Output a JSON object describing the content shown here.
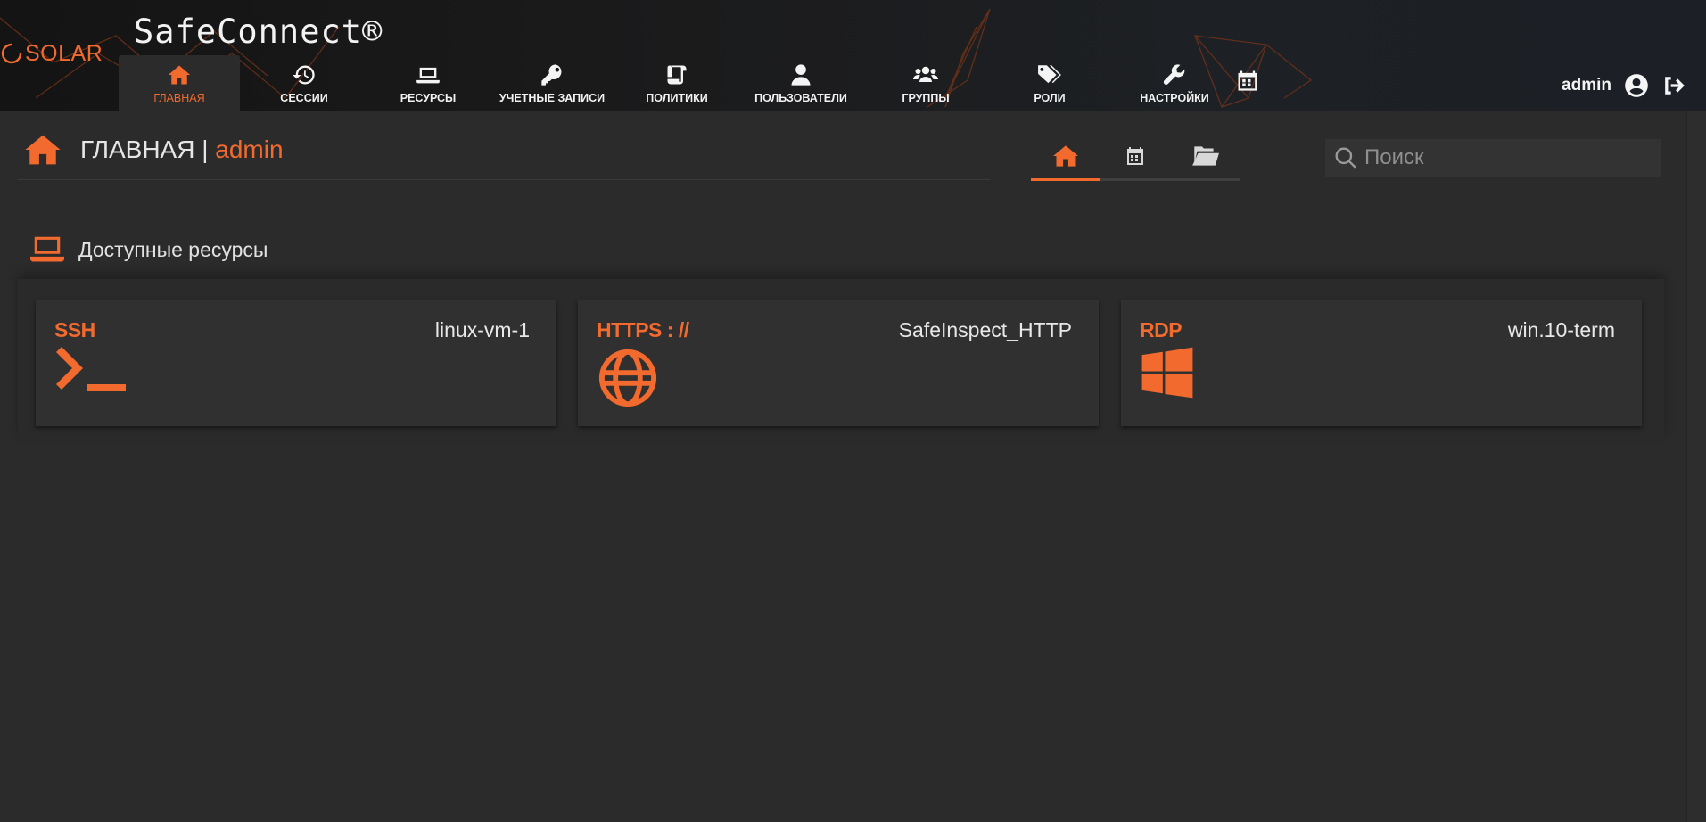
{
  "brand": {
    "logo_text": "SOLAR",
    "app_title": "SafeConnect®",
    "accent": "#f26a2e"
  },
  "nav": {
    "items": [
      {
        "label": "ГЛАВНАЯ",
        "icon": "home-icon",
        "active": true
      },
      {
        "label": "СЕССИИ",
        "icon": "history-icon"
      },
      {
        "label": "РЕСУРСЫ",
        "icon": "laptop-icon"
      },
      {
        "label": "УЧЕТНЫЕ ЗАПИСИ",
        "icon": "key-icon"
      },
      {
        "label": "ПОЛИТИКИ",
        "icon": "scroll-icon"
      },
      {
        "label": "ПОЛЬЗОВАТЕЛИ",
        "icon": "user-icon"
      },
      {
        "label": "ГРУППЫ",
        "icon": "users-icon"
      },
      {
        "label": "РОЛИ",
        "icon": "tags-icon"
      },
      {
        "label": "НАСТРОЙКИ",
        "icon": "wrench-icon"
      }
    ],
    "calendar_icon": "calendar-icon"
  },
  "user": {
    "name": "admin",
    "profile_icon": "user-circle-icon",
    "logout_icon": "sign-out-icon"
  },
  "page": {
    "title": "ГЛАВНАЯ | ",
    "user": "admin",
    "icon": "home-icon"
  },
  "view_tabs": [
    {
      "icon": "home-icon",
      "active": true
    },
    {
      "icon": "calendar-icon"
    },
    {
      "icon": "folder-icon"
    }
  ],
  "search": {
    "placeholder": "Поиск",
    "value": ""
  },
  "resources": {
    "title": "Доступные ресурсы",
    "icon": "laptop-icon",
    "cards": [
      {
        "protocol": "SSH",
        "name": "linux-vm-1",
        "icon": "terminal-icon"
      },
      {
        "protocol": "HTTPS : //",
        "name": "SafeInspect_HTTP",
        "icon": "globe-icon"
      },
      {
        "protocol": "RDP",
        "name": "win.10-term",
        "icon": "windows-icon"
      }
    ]
  }
}
